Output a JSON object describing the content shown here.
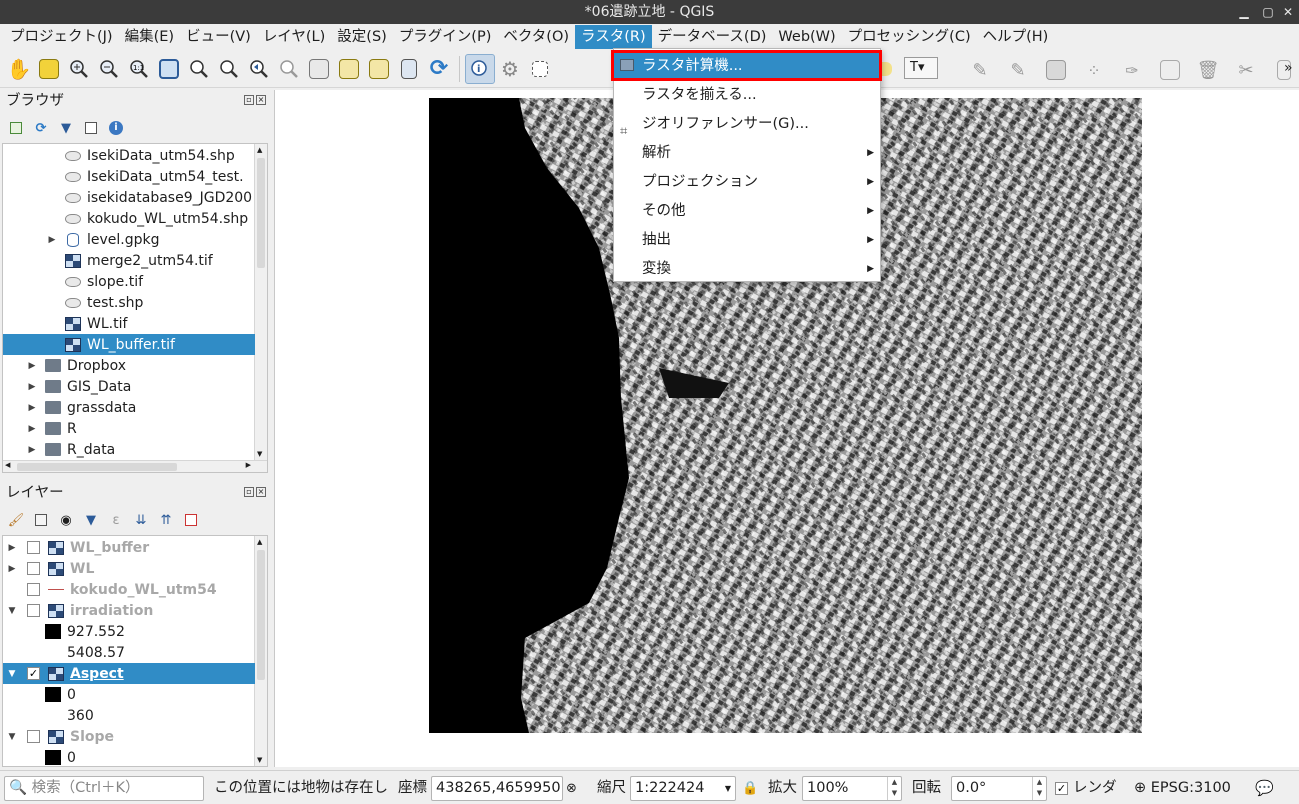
{
  "window": {
    "title": "*06遺跡立地 - QGIS"
  },
  "menubar": {
    "items": [
      "プロジェクト(J)",
      "編集(E)",
      "ビュー(V)",
      "レイヤ(L)",
      "設定(S)",
      "プラグイン(P)",
      "ベクタ(O)",
      "ラスタ(R)",
      "データベース(D)",
      "Web(W)",
      "プロセッシング(C)",
      "ヘルプ(H)"
    ],
    "active_index": 7
  },
  "raster_menu": {
    "items": [
      {
        "label": "ラスタ計算機...",
        "highlighted": true,
        "icon": "raster-calculator-icon"
      },
      {
        "label": "ラスタを揃える...",
        "highlighted": false
      },
      {
        "label": "ジオリファレンサー(G)...",
        "highlighted": false,
        "icon": "georeferencer-icon"
      },
      {
        "label": "解析",
        "submenu": true
      },
      {
        "label": "プロジェクション",
        "submenu": true
      },
      {
        "label": "その他",
        "submenu": true
      },
      {
        "label": "抽出",
        "submenu": true
      },
      {
        "label": "変換",
        "submenu": true
      }
    ]
  },
  "browser": {
    "title": "ブラウザ",
    "items": [
      {
        "label": "IsekiData_utm54.shp",
        "type": "vector",
        "indent": 2
      },
      {
        "label": "IsekiData_utm54_test.",
        "type": "vector",
        "indent": 2
      },
      {
        "label": "isekidatabase9_JGD200",
        "type": "vector",
        "indent": 2
      },
      {
        "label": "kokudo_WL_utm54.shp",
        "type": "vector",
        "indent": 2
      },
      {
        "label": "level.gpkg",
        "type": "db",
        "indent": 2,
        "expandable": true
      },
      {
        "label": "merge2_utm54.tif",
        "type": "raster",
        "indent": 2
      },
      {
        "label": "slope.tif",
        "type": "vector",
        "indent": 2
      },
      {
        "label": "test.shp",
        "type": "vector",
        "indent": 2
      },
      {
        "label": "WL.tif",
        "type": "raster",
        "indent": 2
      },
      {
        "label": "WL_buffer.tif",
        "type": "raster",
        "indent": 2,
        "selected": true
      },
      {
        "label": "Dropbox",
        "type": "folder",
        "indent": 1,
        "expandable": true
      },
      {
        "label": "GIS_Data",
        "type": "folder",
        "indent": 1,
        "expandable": true
      },
      {
        "label": "grassdata",
        "type": "folder",
        "indent": 1,
        "expandable": true
      },
      {
        "label": "R",
        "type": "folder",
        "indent": 1,
        "expandable": true
      },
      {
        "label": "R_data",
        "type": "folder",
        "indent": 1,
        "expandable": true
      }
    ]
  },
  "layers": {
    "title": "レイヤー",
    "items": [
      {
        "label": "WL_buffer",
        "kind": "raster",
        "caret": "right",
        "checked": false
      },
      {
        "label": "WL",
        "kind": "raster",
        "caret": "right",
        "checked": false
      },
      {
        "label": "kokudo_WL_utm54",
        "kind": "line",
        "caret": "",
        "checked": false
      },
      {
        "label": "irradiation",
        "kind": "raster",
        "caret": "down",
        "checked": false
      },
      {
        "label": "927.552",
        "kind": "swatch"
      },
      {
        "label": "5408.57",
        "kind": "legend"
      },
      {
        "label": "Aspect",
        "kind": "raster",
        "caret": "down",
        "checked": true,
        "selected": true
      },
      {
        "label": "0",
        "kind": "swatch"
      },
      {
        "label": "360",
        "kind": "legend"
      },
      {
        "label": "Slope",
        "kind": "raster",
        "caret": "down",
        "checked": false
      },
      {
        "label": "0",
        "kind": "swatch"
      }
    ]
  },
  "statusbar": {
    "search_placeholder": "検索（Ctrl＋K）",
    "message": "この位置には地物は存在し",
    "coord_label": "座標",
    "coord_value": "438265,4659950",
    "scale_label": "縮尺",
    "scale_value": "1:222424",
    "magnifier_label": "拡大",
    "magnifier_value": "100%",
    "rotation_label": "回転",
    "rotation_value": "0.0°",
    "render_label": "レンダ",
    "render_checked": true,
    "crs": "EPSG:3100"
  },
  "colors": {
    "accent": "#308cc6",
    "highlight_box": "#ff0000",
    "titlebar": "#3b3b3b"
  }
}
